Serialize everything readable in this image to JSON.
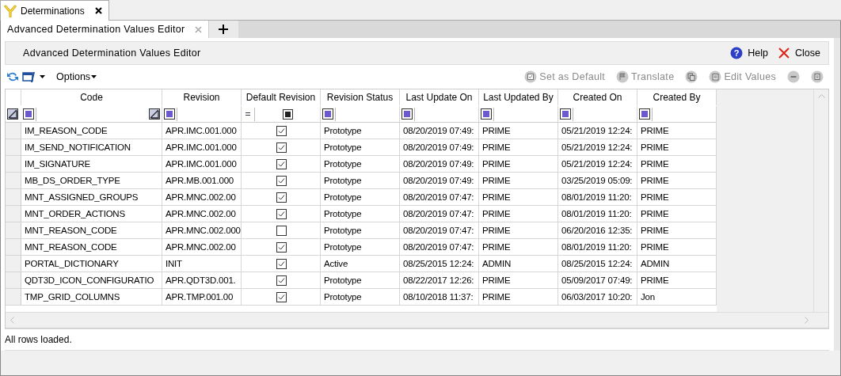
{
  "document_tabs": [
    {
      "label": "Determinations",
      "selected": true
    }
  ],
  "editor_tabs": [
    {
      "label": "Advanced Determination Values Editor",
      "selected": true
    }
  ],
  "panel_title": "Advanced Determination Values Editor",
  "header_actions": [
    {
      "label": "Help",
      "kind": "help",
      "icon": "?"
    },
    {
      "label": "Close",
      "kind": "close"
    }
  ],
  "toolbar": {
    "options_label": "Options",
    "actions": [
      {
        "label": "Set as Default",
        "kind": "set-default",
        "disabled": true
      },
      {
        "label": "Translate",
        "kind": "translate",
        "disabled": true
      },
      {
        "kind": "copy",
        "disabled": true
      },
      {
        "label": "Edit Values",
        "kind": "edit",
        "disabled": true
      },
      {
        "kind": "remove",
        "disabled": true
      },
      {
        "kind": "details",
        "disabled": true
      }
    ]
  },
  "table": {
    "columns": [
      "Code",
      "Revision",
      "Default Revision",
      "Revision Status",
      "Last Update On",
      "Last Updated By",
      "Created On",
      "Created By"
    ],
    "default_filter_operator": "=",
    "default_filter_indeterminate": true,
    "rows": [
      {
        "code": "IM_REASON_CODE",
        "revision": "APR.IMC.001.000",
        "default": true,
        "status": "Prototype",
        "last_update_on": "08/20/2019 07:49:",
        "last_updated_by": "PRIME",
        "created_on": "05/21/2019 12:24:",
        "created_by": "PRIME"
      },
      {
        "code": "IM_SEND_NOTIFICATION",
        "revision": "APR.IMC.001.000",
        "default": true,
        "status": "Prototype",
        "last_update_on": "08/20/2019 07:49:",
        "last_updated_by": "PRIME",
        "created_on": "05/21/2019 12:24:",
        "created_by": "PRIME"
      },
      {
        "code": "IM_SIGNATURE",
        "revision": "APR.IMC.001.000",
        "default": true,
        "status": "Prototype",
        "last_update_on": "08/20/2019 07:49:",
        "last_updated_by": "PRIME",
        "created_on": "05/21/2019 12:24:",
        "created_by": "PRIME"
      },
      {
        "code": "MB_DS_ORDER_TYPE",
        "revision": "APR.MB.001.000",
        "default": true,
        "status": "Prototype",
        "last_update_on": "08/20/2019 07:49:",
        "last_updated_by": "PRIME",
        "created_on": "03/25/2019 05:09:",
        "created_by": "PRIME"
      },
      {
        "code": "MNT_ASSIGNED_GROUPS",
        "revision": "APR.MNC.002.00",
        "default": true,
        "status": "Prototype",
        "last_update_on": "08/20/2019 07:47:",
        "last_updated_by": "PRIME",
        "created_on": "08/01/2019 11:20:",
        "created_by": "PRIME"
      },
      {
        "code": "MNT_ORDER_ACTIONS",
        "revision": "APR.MNC.002.00",
        "default": true,
        "status": "Prototype",
        "last_update_on": "08/20/2019 07:47:",
        "last_updated_by": "PRIME",
        "created_on": "08/01/2019 11:20:",
        "created_by": "PRIME"
      },
      {
        "code": "MNT_REASON_CODE",
        "revision": "APR.MNC.002.000",
        "default": false,
        "status": "Prototype",
        "last_update_on": "08/20/2019 07:47:",
        "last_updated_by": "PRIME",
        "created_on": "06/20/2016 12:35:",
        "created_by": "PRIME"
      },
      {
        "code": "MNT_REASON_CODE",
        "revision": "APR.MNC.002.00",
        "default": true,
        "status": "Prototype",
        "last_update_on": "08/20/2019 07:47:",
        "last_updated_by": "PRIME",
        "created_on": "08/01/2019 11:20:",
        "created_by": "PRIME"
      },
      {
        "code": "PORTAL_DICTIONARY",
        "revision": "INIT",
        "default": true,
        "status": "Active",
        "last_update_on": "08/25/2015 12:24:",
        "last_updated_by": "ADMIN",
        "created_on": "08/25/2015 12:24:",
        "created_by": "ADMIN"
      },
      {
        "code": "QDT3D_ICON_CONFIGURATIO",
        "revision": "APR.QDT3D.001.",
        "default": true,
        "status": "Prototype",
        "last_update_on": "08/22/2017 12:26:",
        "last_updated_by": "PRIME",
        "created_on": "05/09/2017 07:49:",
        "created_by": "PRIME"
      },
      {
        "code": "TMP_GRID_COLUMNS",
        "revision": "APR.TMP.001.00",
        "default": true,
        "status": "Prototype",
        "last_update_on": "08/10/2018 11:37:",
        "last_updated_by": "PRIME",
        "created_on": "06/03/2017 10:20:",
        "created_by": "Jon"
      }
    ]
  },
  "status_bar": "All rows loaded."
}
